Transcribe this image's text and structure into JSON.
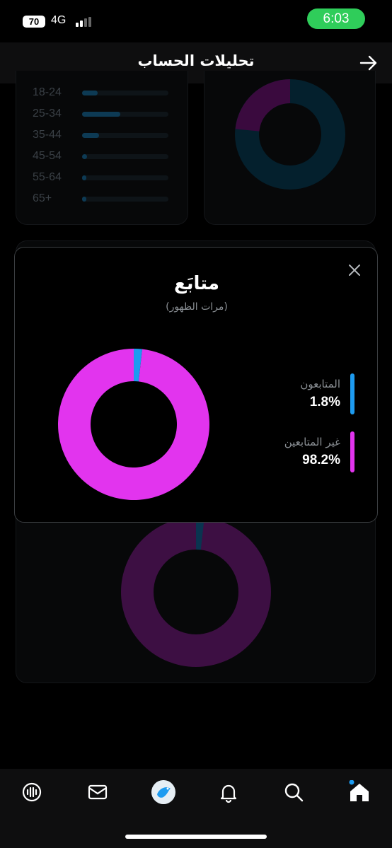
{
  "status_bar": {
    "battery": "70",
    "network": "4G",
    "time": "6:03"
  },
  "header": {
    "title": "تحليلات الحساب"
  },
  "age_breakdown": {
    "rows": [
      {
        "label": "18-24",
        "fraction": 0.18
      },
      {
        "label": "25-34",
        "fraction": 0.44
      },
      {
        "label": "35-44",
        "fraction": 0.2
      },
      {
        "label": "45-54",
        "fraction": 0.06
      },
      {
        "label": "55-64",
        "fraction": 0.03
      },
      {
        "label": "65+",
        "fraction": 0.03
      }
    ]
  },
  "modal": {
    "title": "متابَع",
    "subtitle": "(مرات الظهور)",
    "legend": [
      {
        "label": "المتابعون",
        "value": "1.8%",
        "color": "#1d9bf0"
      },
      {
        "label": "غير المتابعين",
        "value": "98.2%",
        "color": "#e234ee"
      }
    ]
  },
  "chart_data": {
    "type": "pie",
    "categories": [
      "المتابعون",
      "غير المتابعين"
    ],
    "values": [
      1.8,
      98.2
    ],
    "colors": [
      "#1d9bf0",
      "#e234ee"
    ],
    "donut": true
  },
  "nav": {
    "items": [
      "spaces-icon",
      "messages-icon",
      "avatar",
      "notifications-icon",
      "search-icon",
      "home-icon"
    ]
  },
  "colors": {
    "accent_blue": "#1d9bf0",
    "accent_magenta": "#e234ee",
    "status_green": "#2fcd5a"
  }
}
